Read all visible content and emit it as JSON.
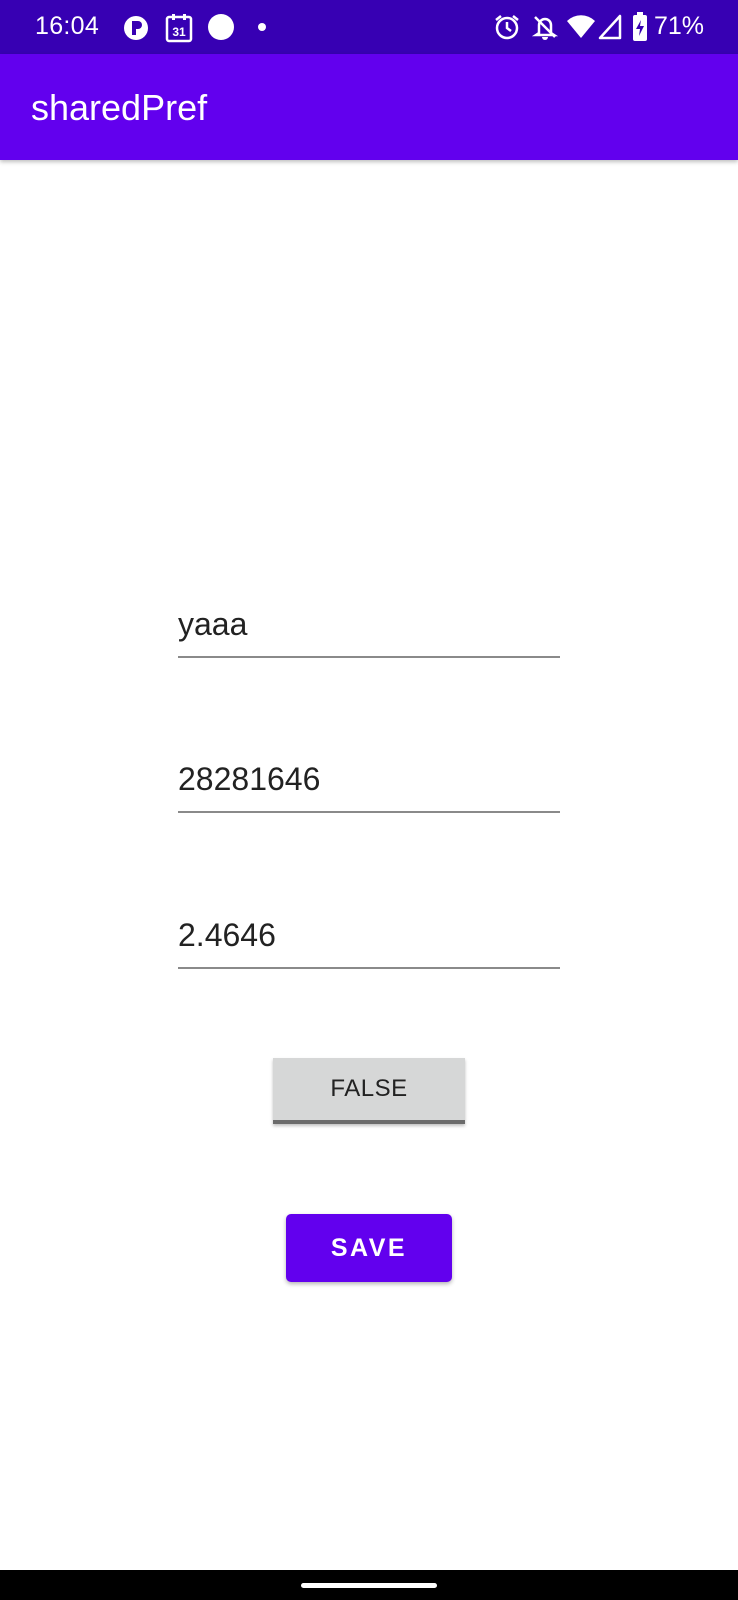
{
  "status_bar": {
    "time": "16:04",
    "battery_percent": "71%",
    "calendar_day": "31",
    "icons": [
      "app-notification-icon",
      "calendar-icon",
      "circle-notification-icon",
      "dot-icon",
      "alarm-icon",
      "notifications-off-icon",
      "wifi-icon",
      "signal-icon",
      "battery-charging-icon"
    ]
  },
  "app_bar": {
    "title": "sharedPref"
  },
  "form": {
    "field1_value": "yaaa",
    "field2_value": "28281646",
    "field3_value": "2.4646",
    "toggle_label": "FALSE",
    "save_label": "SAVE"
  },
  "colors": {
    "status_bar": "#3700b3",
    "primary": "#6200ee",
    "toggle_bg": "#d6d7d7",
    "text": "#222222"
  }
}
